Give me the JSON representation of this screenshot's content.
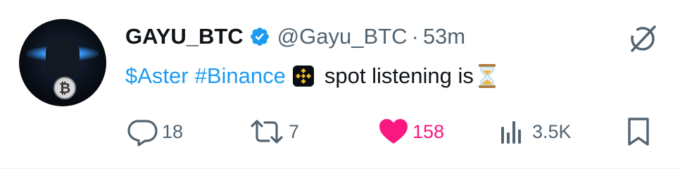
{
  "tweet": {
    "display_name": "GAYU_BTC",
    "handle": "@Gayu_BTC",
    "separator": "·",
    "time": "53m",
    "text": {
      "cashtag": "$Aster",
      "hashtag": "#Binance",
      "rest": "spot listening is"
    },
    "colors": {
      "link": "#1d9bf0",
      "verified": "#1d9bf0",
      "like": "#f91880",
      "muted": "#536471"
    },
    "actions": {
      "replies": "18",
      "reposts": "7",
      "likes": "158",
      "views": "3.5K"
    },
    "icons": [
      "verified-badge-icon",
      "grok-icon",
      "binance-logo-icon",
      "hourglass-icon",
      "reply-icon",
      "repost-icon",
      "heart-icon",
      "views-icon",
      "bookmark-icon"
    ]
  }
}
